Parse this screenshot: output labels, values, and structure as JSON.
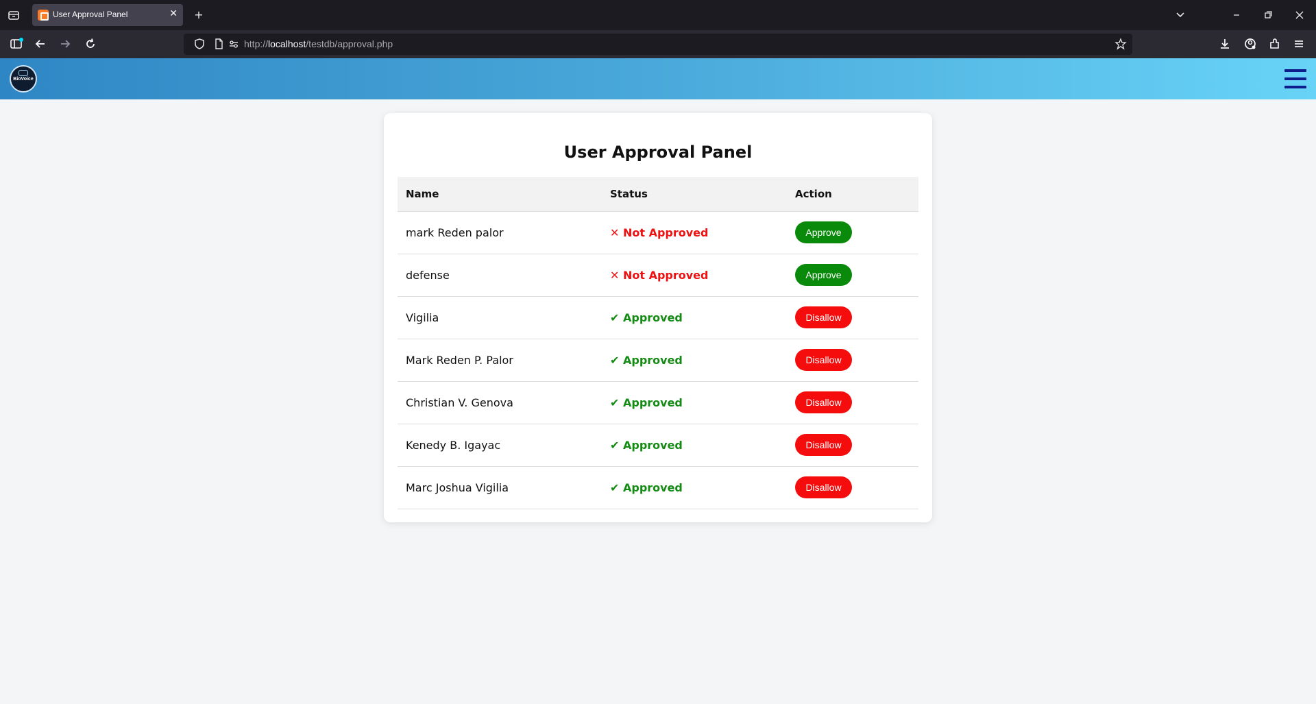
{
  "browser": {
    "tab_title": "User Approval Panel",
    "tab_close": "✕",
    "new_tab": "+",
    "url_prefix": "http://",
    "url_host": "localhost",
    "url_path": "/testdb/approval.php"
  },
  "site": {
    "logo_text": "BioVoice"
  },
  "panel": {
    "title": "User Approval Panel",
    "columns": [
      "Name",
      "Status",
      "Action"
    ],
    "rows": [
      {
        "name": "mark Reden palor",
        "status": "✕ Not Approved",
        "approved": false,
        "action": "Approve"
      },
      {
        "name": "defense",
        "status": "✕ Not Approved",
        "approved": false,
        "action": "Approve"
      },
      {
        "name": "Vigilia",
        "status": "✔ Approved",
        "approved": true,
        "action": "Disallow"
      },
      {
        "name": "Mark Reden P. Palor",
        "status": "✔ Approved",
        "approved": true,
        "action": "Disallow"
      },
      {
        "name": "Christian V. Genova",
        "status": "✔ Approved",
        "approved": true,
        "action": "Disallow"
      },
      {
        "name": "Kenedy B. Igayac",
        "status": "✔ Approved",
        "approved": true,
        "action": "Disallow"
      },
      {
        "name": "Marc Joshua Vigilia",
        "status": "✔ Approved",
        "approved": true,
        "action": "Disallow"
      }
    ]
  },
  "colors": {
    "approve_button": "#0a8a0a",
    "disallow_button": "#f50d0d",
    "not_approved_text": "#ee1111",
    "approved_text": "#148c14",
    "header_gradient_start": "#2f86c4",
    "header_gradient_end": "#68d3f7"
  },
  "icons": {
    "tab_list": "tab-list-icon",
    "back": "back-arrow-icon",
    "forward": "forward-arrow-icon",
    "reload": "reload-icon",
    "shield": "shield-icon",
    "page": "page-icon",
    "permissions": "permissions-icon",
    "bookmark": "star-icon",
    "downloads": "download-icon",
    "account": "account-icon",
    "extensions": "extensions-icon",
    "app_menu": "app-menu-icon",
    "site_menu": "hamburger-menu-icon"
  }
}
